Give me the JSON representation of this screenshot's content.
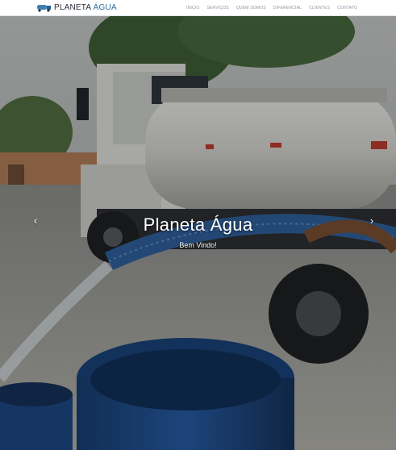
{
  "brand": {
    "name_part1": "PLANETA",
    "name_part2": "ÁGUA",
    "logo_icon": "water-truck-icon"
  },
  "nav": {
    "items": [
      "INICIO",
      "SERVIÇOS",
      "QUEM SOMOS",
      "DIFERENCIAL",
      "CLIENTES",
      "CONTATO"
    ]
  },
  "hero": {
    "title": "Planeta Água",
    "subtitle": "Bem Vindo!",
    "prev_icon": "chevron-left-icon",
    "next_icon": "chevron-right-icon",
    "prev_glyph": "‹",
    "next_glyph": "›"
  },
  "colors": {
    "brand_blue": "#2b6f9e",
    "nav_text": "#8a96a3",
    "barrel_blue": "#1f4f8f"
  }
}
